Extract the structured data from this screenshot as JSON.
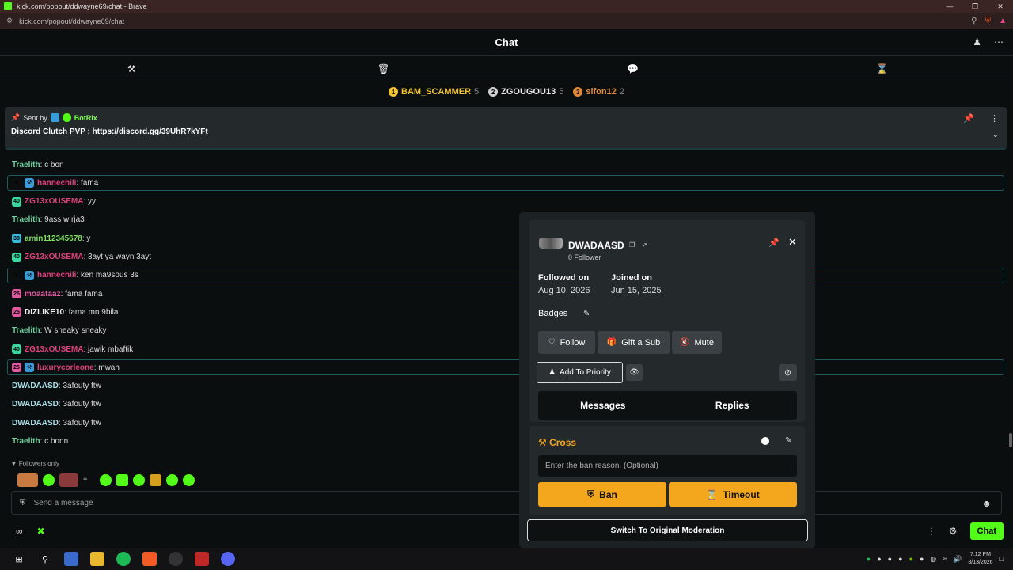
{
  "browser": {
    "window_title": "kick.com/popout/ddwayne69/chat - Brave",
    "url": "kick.com/popout/ddwayne69/chat"
  },
  "header": {
    "title": "Chat"
  },
  "leaderboard": [
    {
      "rank": "1",
      "name": "BAM_SCAMMER",
      "count": "5",
      "color": "#f4c430"
    },
    {
      "rank": "2",
      "name": "ZGOUGOU13",
      "count": "5",
      "color": "#d0d0d0"
    },
    {
      "rank": "3",
      "name": "sifon12",
      "count": "2",
      "color": "#e08a3a"
    }
  ],
  "pinned": {
    "sent_by_label": "Sent by",
    "bot_name": "BotRix",
    "text": "Discord Clutch PVP : ",
    "link": "https://discord.gg/39UhR7kYFt"
  },
  "messages": [
    {
      "user": "Traelith",
      "text": ": c bon",
      "color": "#6fd0a0",
      "badge": "",
      "highlight": false
    },
    {
      "user": "hannechili",
      "text": ": fama",
      "color": "#e0407a",
      "badge": "star-mod",
      "highlight": true
    },
    {
      "user": "ZG13xOUSEMA",
      "text": ": yy",
      "color": "#e0407a",
      "badge": "40",
      "highlight": false
    },
    {
      "user": "Traelith",
      "text": ": 9ass w rja3",
      "color": "#6fd0a0",
      "badge": "",
      "highlight": false
    },
    {
      "user": "amin112345678",
      "text": ": y",
      "color": "#7fe060",
      "badge": "38",
      "highlight": false
    },
    {
      "user": "ZG13xOUSEMA",
      "text": ": 3ayt ya wayn 3ayt",
      "color": "#e0407a",
      "badge": "40",
      "highlight": false
    },
    {
      "user": "hannechili",
      "text": ": ken ma9sous 3s",
      "color": "#e0407a",
      "badge": "star-mod",
      "highlight": true
    },
    {
      "user": "moaataaz",
      "text": ": fama fama",
      "color": "#e05aa0",
      "badge": "25",
      "highlight": false
    },
    {
      "user": "DIZLIKE10",
      "text": ": fama mn 9bila",
      "color": "#f0f0f0",
      "badge": "25",
      "highlight": false
    },
    {
      "user": "Traelith",
      "text": ": W sneaky sneaky",
      "color": "#6fd0a0",
      "badge": "",
      "highlight": false
    },
    {
      "user": "ZG13xOUSEMA",
      "text": ": jawik mbaftik",
      "color": "#e0407a",
      "badge": "40",
      "highlight": false
    },
    {
      "user": "luxurycorleone",
      "text": ": mwah",
      "color": "#e0407a",
      "badge": "25-mod",
      "highlight": true
    },
    {
      "user": "DWADAASD",
      "text": ": 3afouty ftw",
      "color": "#a8e0e8",
      "badge": "",
      "highlight": false
    },
    {
      "user": "DWADAASD",
      "text": ": 3afouty ftw",
      "color": "#a8e0e8",
      "badge": "",
      "highlight": false
    },
    {
      "user": "DWADAASD",
      "text": ": 3afouty ftw",
      "color": "#a8e0e8",
      "badge": "",
      "highlight": false
    },
    {
      "user": "Traelith",
      "text": ": c bonn",
      "color": "#6fd0a0",
      "badge": "",
      "highlight": false
    }
  ],
  "followers_only": "Followers only",
  "input": {
    "placeholder": "Send a message"
  },
  "bottom": {
    "chat_button": "Chat"
  },
  "popup": {
    "username": "DWADAASD",
    "followers": "0 Follower",
    "followed_on_label": "Followed on",
    "followed_on": "Aug 10, 2026",
    "joined_on_label": "Joined on",
    "joined_on": "Jun 15, 2025",
    "badges_label": "Badges",
    "follow_label": "Follow",
    "gift_label": "Gift a Sub",
    "mute_label": "Mute",
    "priority_label": "Add To Priority",
    "tab_messages": "Messages",
    "tab_replies": "Replies",
    "mod_title": "Cross",
    "ban_reason_placeholder": "Enter the ban reason. (Optional)",
    "ban_label": "Ban",
    "timeout_label": "Timeout",
    "switch_label": "Switch To Original Moderation"
  },
  "taskbar": {
    "time": "7:12 PM",
    "date": "8/13/2026"
  },
  "colors": {
    "accent": "#53fc18",
    "mod_action": "#f4a61d"
  }
}
